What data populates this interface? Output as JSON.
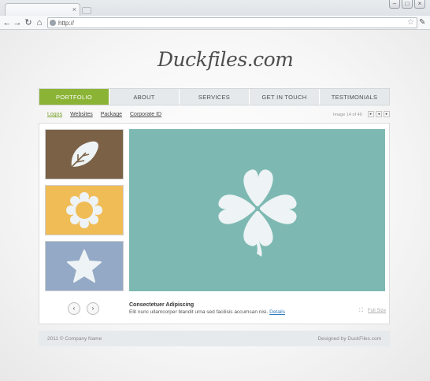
{
  "browser": {
    "tab_close": "×",
    "url": "http://",
    "window_buttons": [
      "–",
      "□",
      "×"
    ]
  },
  "site": {
    "logo": "Duckfiles.com",
    "nav": [
      "PORTFOLIO",
      "ABOUT",
      "SERVICES",
      "GET IN TOUCH",
      "TESTIMONIALS"
    ],
    "subnav": [
      "Logos",
      "Websites",
      "Package",
      "Corporate ID"
    ],
    "image_counter": "Image 14 of 49",
    "caption_title": "Consectetuer Adipiscing",
    "caption_text": "Elit nunc ullamcorper blandit urna sed facilisis accumsan nisi.",
    "details_link": "Details",
    "full_size": "Full Size",
    "footer_left": "2011 © Company Name",
    "footer_right": "Designed by DuckFiles.com"
  },
  "colors": {
    "accent": "#8bb436",
    "thumb_brown": "#7b6246",
    "thumb_yellow": "#f0bc56",
    "thumb_blue": "#94a9c6",
    "main_teal": "#7db9b2",
    "icon_fill": "#eef3f5"
  },
  "icons": {
    "thumbnails": [
      "leaf-icon",
      "flower-ring-icon",
      "star-icon"
    ],
    "main_image": "clover-icon"
  }
}
